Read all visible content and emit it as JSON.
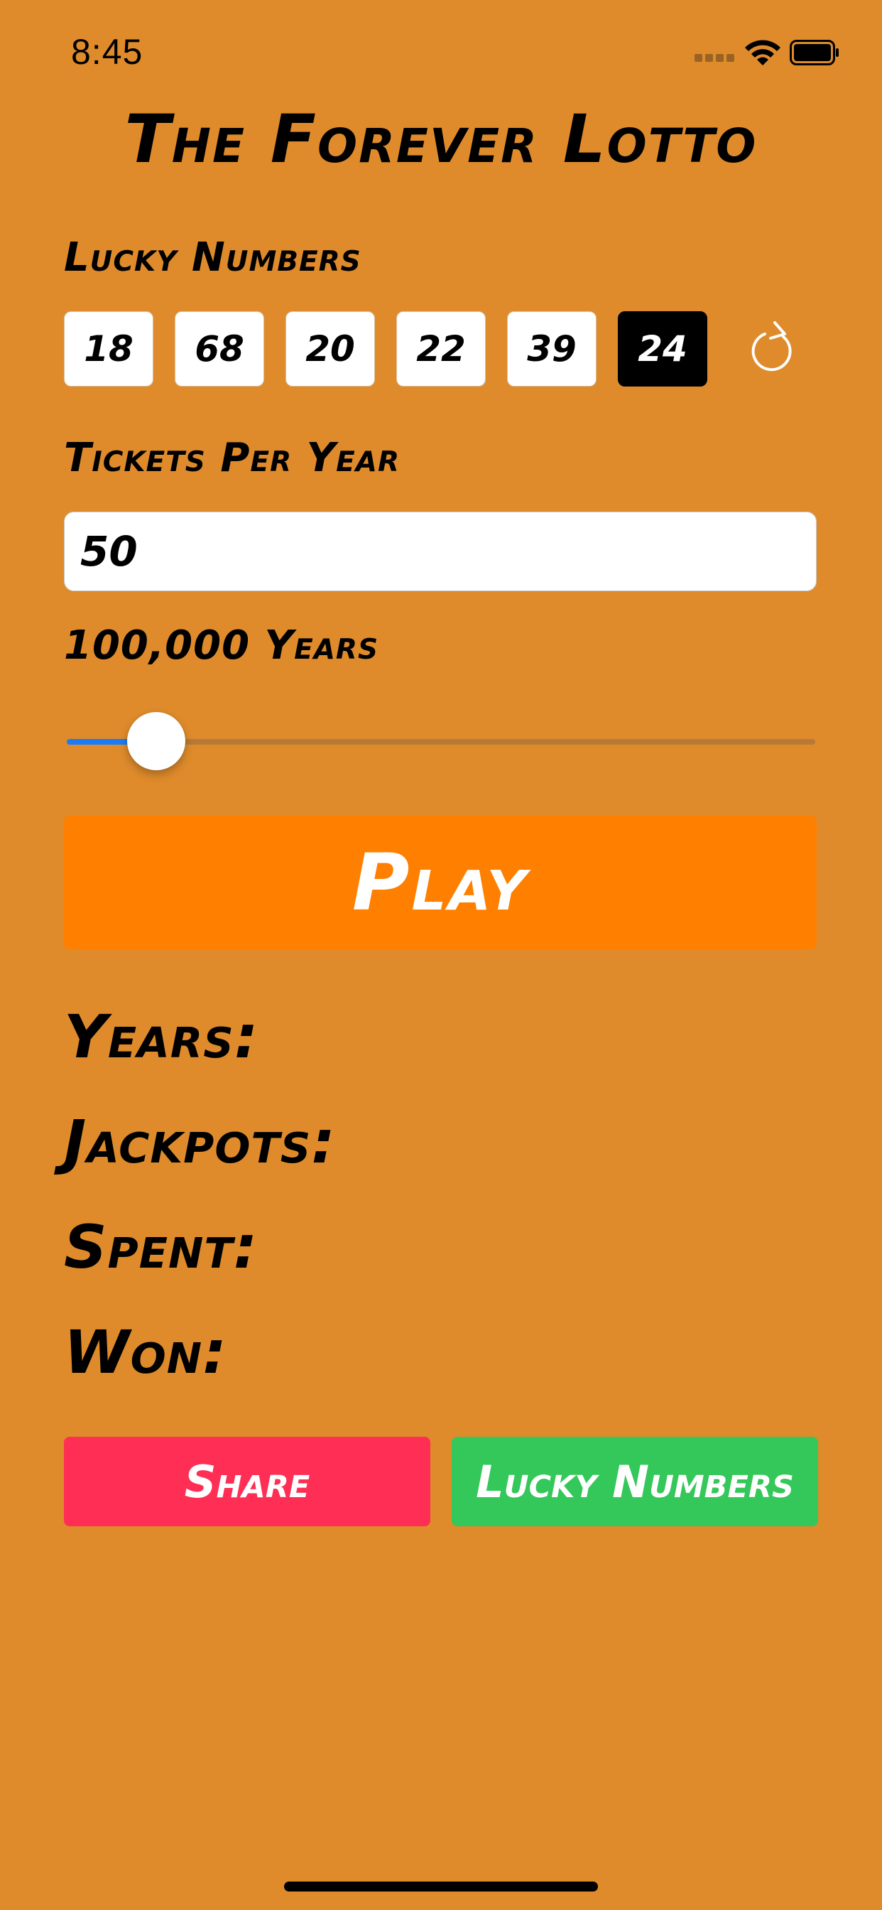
{
  "status_bar": {
    "time": "8:45"
  },
  "title": "The Forever Lotto",
  "lucky_numbers": {
    "label": "Lucky Numbers",
    "balls": [
      "18",
      "68",
      "20",
      "22",
      "39"
    ],
    "power_ball": "24"
  },
  "tickets": {
    "label": "Tickets Per Year",
    "value": "50"
  },
  "years": {
    "label": "100,000 Years",
    "slider_fraction": 0.12
  },
  "play_label": "Play",
  "results": {
    "years": "Years:",
    "jackpots": "Jackpots:",
    "spent": "Spent:",
    "won": "Won:"
  },
  "buttons": {
    "share": "Share",
    "lucky_numbers": "Lucky Numbers"
  },
  "colors": {
    "background": "#df8b2b",
    "play": "#ff7f00",
    "share": "#ff2e55",
    "lucky": "#34c759",
    "slider": "#1a7cf7"
  }
}
